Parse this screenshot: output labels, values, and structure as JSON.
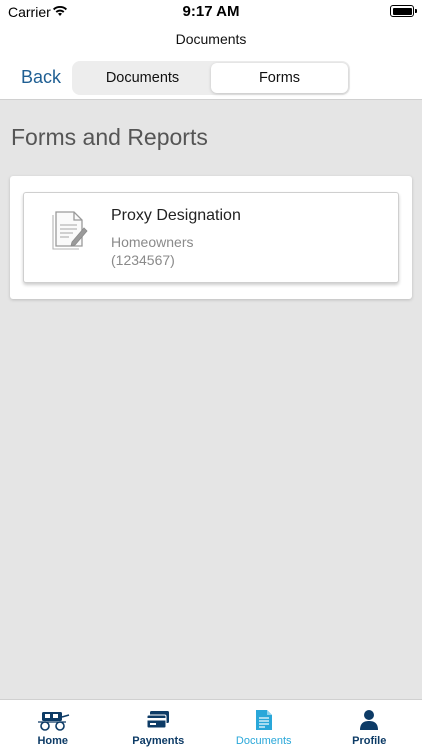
{
  "status_bar": {
    "carrier": "Carrier",
    "time": "9:17 AM"
  },
  "nav": {
    "title": "Documents",
    "back_label": "Back",
    "segments": [
      {
        "label": "Documents",
        "active": false
      },
      {
        "label": "Forms",
        "active": true
      }
    ]
  },
  "main": {
    "section_title": "Forms and Reports",
    "forms": [
      {
        "name": "Proxy Designation",
        "subtitle": "Homeowners",
        "id_text": "(1234567)"
      }
    ]
  },
  "tab_bar": {
    "items": [
      {
        "label": "Home",
        "icon": "stagecoach-icon",
        "active": false
      },
      {
        "label": "Payments",
        "icon": "credit-card-icon",
        "active": false
      },
      {
        "label": "Documents",
        "icon": "document-icon",
        "active": true
      },
      {
        "label": "Profile",
        "icon": "person-icon",
        "active": false
      }
    ]
  },
  "colors": {
    "accent_blue": "#1f5f93",
    "tab_inactive": "#0d3b66",
    "tab_active": "#29a7d9",
    "background": "#e5e5e5"
  }
}
